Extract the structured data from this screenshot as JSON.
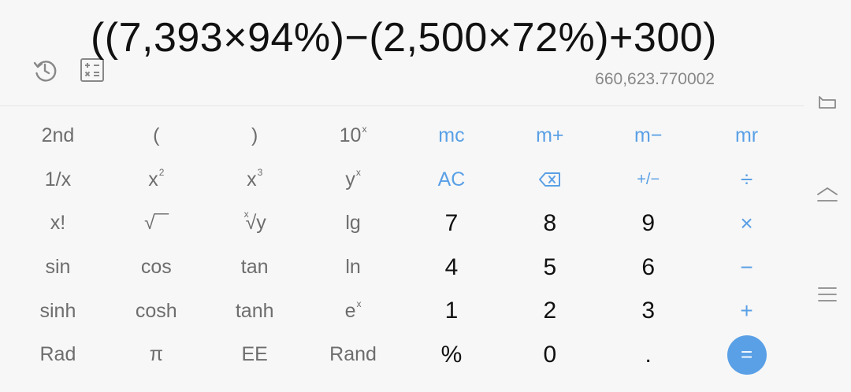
{
  "display": {
    "expression": "((7,393×94%)−(2,500×72%)+300)",
    "result": "660,623.770002"
  },
  "header_icons": {
    "history": "history-icon",
    "converter": "unit-converter-icon"
  },
  "keys": {
    "second": "2nd",
    "paren_open": "(",
    "paren_close": ")",
    "ten_pow_base": "10",
    "ten_pow_sup": "x",
    "mc": "mc",
    "mplus": "m+",
    "mminus": "m−",
    "mr": "mr",
    "reciprocal": "1/x",
    "x_base": "x",
    "square_sup": "2",
    "cube_sup": "3",
    "y_base": "y",
    "y_pow_sup": "x",
    "ac": "AC",
    "plus_minus": "+/−",
    "divide": "÷",
    "factorial": "x!",
    "sqrt": "√‾‾",
    "root_index": "x",
    "root_sign": "√",
    "root_base": "y",
    "lg": "lg",
    "d7": "7",
    "d8": "8",
    "d9": "9",
    "multiply": "×",
    "sin": "sin",
    "cos": "cos",
    "tan": "tan",
    "ln": "ln",
    "d4": "4",
    "d5": "5",
    "d6": "6",
    "minus": "−",
    "sinh": "sinh",
    "cosh": "cosh",
    "tanh": "tanh",
    "e_base": "e",
    "e_pow_sup": "x",
    "d1": "1",
    "d2": "2",
    "d3": "3",
    "plus": "+",
    "rad": "Rad",
    "pi": "π",
    "ee": "EE",
    "rand": "Rand",
    "percent": "%",
    "d0": "0",
    "dot": ".",
    "equals": "="
  },
  "colors": {
    "accent": "#5aa0e6",
    "background": "#f7f7f7",
    "sci_text": "#6d6d6d",
    "num_text": "#111111"
  },
  "nav": {
    "back": "back-icon",
    "home": "home-icon",
    "menu": "menu-icon"
  }
}
